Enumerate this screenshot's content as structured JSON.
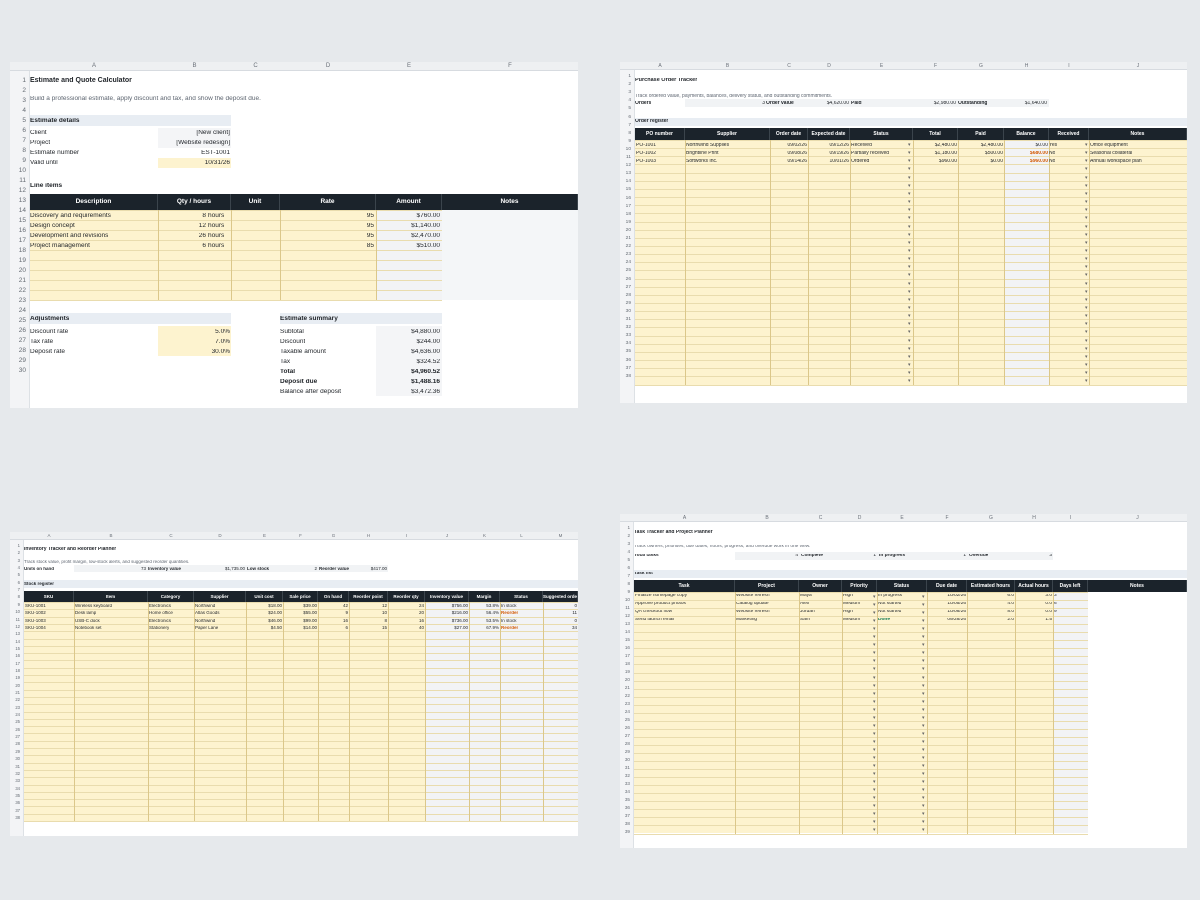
{
  "estimate": {
    "cols": [
      "A",
      "B",
      "C",
      "D",
      "E",
      "F"
    ],
    "title": "Estimate and Quote Calculator",
    "subtitle": "Build a professional estimate, apply discount and tax, and show the deposit due.",
    "details_heading": "Estimate details",
    "details": [
      {
        "label": "Client",
        "value": "[New client]"
      },
      {
        "label": "Project",
        "value": "[Website redesign]"
      },
      {
        "label": "Estimate number",
        "value": "EST-1001"
      },
      {
        "label": "Valid until",
        "value": "10/31/26"
      }
    ],
    "line_items_heading": "Line items",
    "table_headers": [
      "Description",
      "Qty / hours",
      "Unit",
      "Rate",
      "Amount",
      "Notes"
    ],
    "items": [
      {
        "desc": "Discovery and requirements",
        "qty": "8",
        "unit": "hours",
        "rate": "95",
        "amount": "$760.00"
      },
      {
        "desc": "Design concept",
        "qty": "12",
        "unit": "hours",
        "rate": "95",
        "amount": "$1,140.00"
      },
      {
        "desc": "Development and revisions",
        "qty": "26",
        "unit": "hours",
        "rate": "95",
        "amount": "$2,470.00"
      },
      {
        "desc": "Project management",
        "qty": "6",
        "unit": "hours",
        "rate": "85",
        "amount": "$510.00"
      }
    ],
    "adjustments_heading": "Adjustments",
    "adjustments": [
      {
        "label": "Discount rate",
        "value": "5.0%"
      },
      {
        "label": "Tax rate",
        "value": "7.0%"
      },
      {
        "label": "Deposit rate",
        "value": "30.0%"
      }
    ],
    "summary_heading": "Estimate summary",
    "summary": [
      {
        "label": "Subtotal",
        "value": "$4,880.00"
      },
      {
        "label": "Discount",
        "value": "$244.00"
      },
      {
        "label": "Taxable amount",
        "value": "$4,636.00"
      },
      {
        "label": "Tax",
        "value": "$324.52"
      },
      {
        "label": "Total",
        "value": "$4,960.52"
      },
      {
        "label": "Deposit due",
        "value": "$1,488.16"
      },
      {
        "label": "Balance after deposit",
        "value": "$3,472.36"
      }
    ]
  },
  "purchase": {
    "cols": [
      "A",
      "B",
      "C",
      "D",
      "E",
      "F",
      "G",
      "H",
      "I",
      "J"
    ],
    "title": "Purchase Order Tracker",
    "subtitle": "Track ordered value, payments, balances, delivery status, and outstanding commitments.",
    "metrics": {
      "orders_label": "Orders",
      "orders_value": "3",
      "order_value_label": "Order value",
      "order_value": "$4,620.00",
      "paid_label": "Paid",
      "paid_value": "$2,980.00",
      "outstanding_label": "Outstanding",
      "outstanding_value": "$1,640.00"
    },
    "register_heading": "Order register",
    "table_headers": [
      "PO number",
      "Supplier",
      "Order date",
      "Expected date",
      "Status",
      "Total",
      "Paid",
      "Balance",
      "Received",
      "Notes"
    ],
    "orders": [
      {
        "po": "PO-1001",
        "supplier": "Northwind Supplies",
        "order_date": "09/02/26",
        "expected": "09/12/26",
        "status": "Received",
        "total": "$2,480.00",
        "paid": "$2,480.00",
        "balance": "$0.00",
        "received": "Yes",
        "notes": "Office equipment"
      },
      {
        "po": "PO-1002",
        "supplier": "Brightline Print",
        "order_date": "09/08/26",
        "expected": "09/19/26",
        "status": "Partially received",
        "total": "$1,180.00",
        "paid": "$500.00",
        "balance": "$680.00",
        "received": "No",
        "notes": "Seasonal collateral"
      },
      {
        "po": "PO-1003",
        "supplier": "Softworks Inc.",
        "order_date": "09/14/26",
        "expected": "10/01/26",
        "status": "Ordered",
        "total": "$960.00",
        "paid": "$0.00",
        "balance": "$960.00",
        "received": "No",
        "notes": "Annual workspace plan"
      }
    ]
  },
  "inventory": {
    "cols": [
      "A",
      "B",
      "C",
      "D",
      "E",
      "F",
      "G",
      "H",
      "I",
      "J",
      "K",
      "L",
      "M"
    ],
    "title": "Inventory Tracker and Reorder Planner",
    "subtitle": "Track stock value, profit margin, low-stock alerts, and suggested reorder quantities.",
    "metrics": {
      "units_label": "Units on hand",
      "units_value": "73",
      "inv_label": "Inventory value",
      "inv_value": "$1,735.00",
      "low_label": "Low stock",
      "low_value": "2",
      "reorder_label": "Reorder value",
      "reorder_value": "$417.00"
    },
    "register_heading": "Stock register",
    "table_headers": [
      "SKU",
      "Item",
      "Category",
      "Supplier",
      "Unit cost",
      "Sale price",
      "On hand",
      "Reorder point",
      "Reorder qty",
      "Inventory value",
      "Margin",
      "Status",
      "Suggested order"
    ],
    "items": [
      {
        "sku": "SKU-1001",
        "item": "Wireless keyboard",
        "category": "Electronics",
        "supplier": "Northwind",
        "cost": "$18.00",
        "price": "$39.00",
        "on_hand": "42",
        "point": "12",
        "qty": "24",
        "value": "$756.00",
        "margin": "53.8%",
        "status": "In stock",
        "suggested": "0"
      },
      {
        "sku": "SKU-1002",
        "item": "Desk lamp",
        "category": "Home office",
        "supplier": "Atlas Goods",
        "cost": "$24.00",
        "price": "$55.00",
        "on_hand": "9",
        "point": "10",
        "qty": "20",
        "value": "$216.00",
        "margin": "56.4%",
        "status": "Reorder",
        "suggested": "11"
      },
      {
        "sku": "SKU-1003",
        "item": "USB-C dock",
        "category": "Electronics",
        "supplier": "Northwind",
        "cost": "$46.00",
        "price": "$99.00",
        "on_hand": "16",
        "point": "8",
        "qty": "16",
        "value": "$736.00",
        "margin": "53.5%",
        "status": "In stock",
        "suggested": "0"
      },
      {
        "sku": "SKU-1004",
        "item": "Notebook set",
        "category": "Stationery",
        "supplier": "Paper Lane",
        "cost": "$4.50",
        "price": "$14.00",
        "on_hand": "6",
        "point": "15",
        "qty": "40",
        "value": "$27.00",
        "margin": "67.9%",
        "status": "Reorder",
        "suggested": "34"
      }
    ]
  },
  "tasks": {
    "cols": [
      "A",
      "B",
      "C",
      "D",
      "E",
      "F",
      "G",
      "H",
      "I",
      "J"
    ],
    "title": "Task Tracker and Project Planner",
    "subtitle": "Track owners, priorities, due dates, hours, progress, and overdue work in one view.",
    "metrics": {
      "total_label": "Total tasks",
      "total_value": "4",
      "complete_label": "Complete",
      "complete_value": "1",
      "progress_label": "In progress",
      "progress_value": "1",
      "overdue_label": "Overdue",
      "overdue_value": "3"
    },
    "list_heading": "Task list",
    "table_headers": [
      "Task",
      "Project",
      "Owner",
      "Priority",
      "Status",
      "Due date",
      "Estimated hours",
      "Actual hours",
      "Days left",
      "Notes"
    ],
    "items": [
      {
        "task": "Finalize homepage copy",
        "project": "Website refresh",
        "owner": "Maya",
        "priority": "High",
        "status": "In progress",
        "due": "10/02/26",
        "est": "6.0",
        "actual": "3.0",
        "days": "3"
      },
      {
        "task": "Approve product photos",
        "project": "Catalog update",
        "owner": "Alex",
        "priority": "Medium",
        "status": "Not started",
        "due": "10/05/26",
        "est": "4.0",
        "actual": "0.0",
        "days": "6"
      },
      {
        "task": "QA checkout flow",
        "project": "Website refresh",
        "owner": "Jordan",
        "priority": "High",
        "status": "Not started",
        "due": "10/08/26",
        "est": "8.0",
        "actual": "0.0",
        "days": "9"
      },
      {
        "task": "Send launch email",
        "project": "Marketing",
        "owner": "Sam",
        "priority": "Medium",
        "status": "Done",
        "due": "09/28/26",
        "est": "2.0",
        "actual": "1.5",
        "days": ""
      }
    ]
  }
}
